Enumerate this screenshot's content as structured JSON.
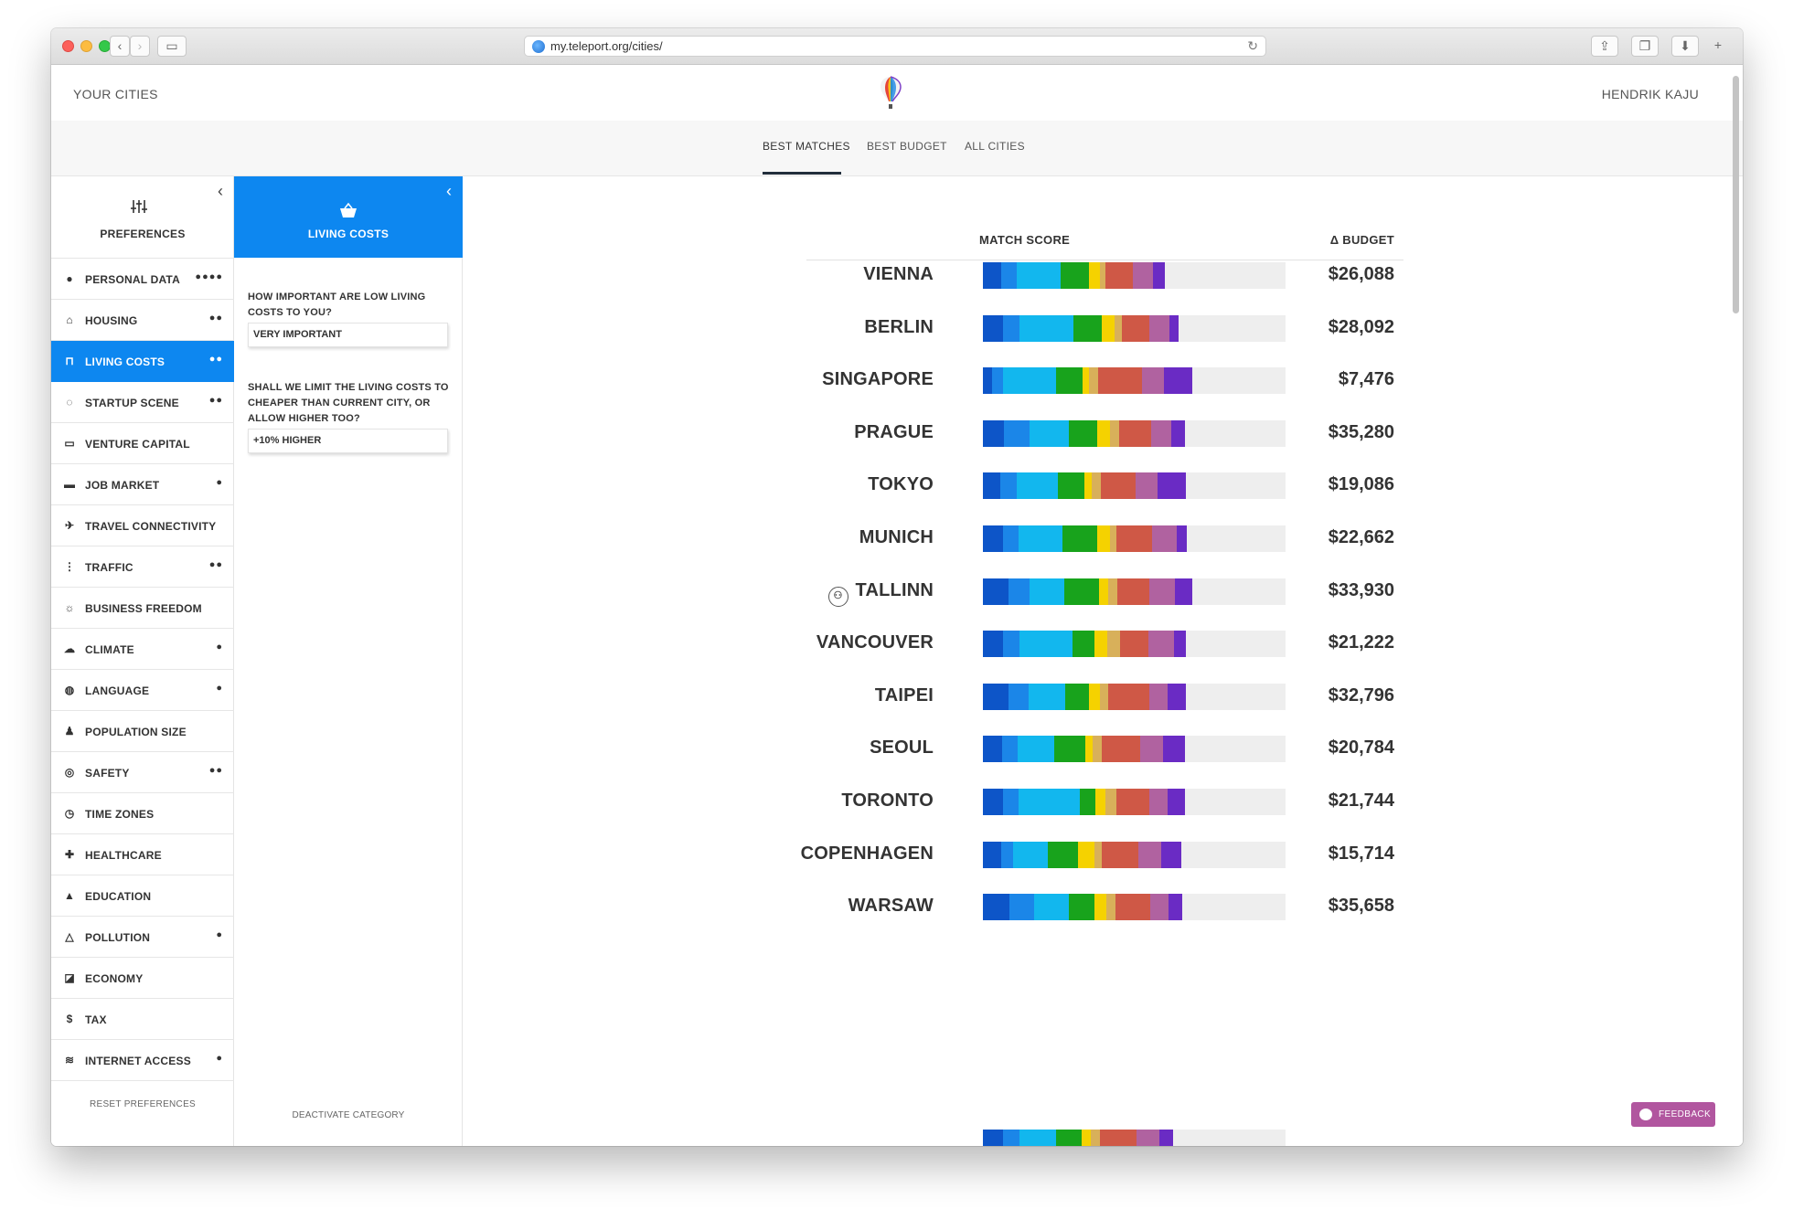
{
  "browser": {
    "url": "my.teleport.org/cities/"
  },
  "header": {
    "left_link": "YOUR CITIES",
    "user_name": "HENDRIK KAJU",
    "tabs": [
      {
        "label": "BEST MATCHES",
        "active": true
      },
      {
        "label": "BEST BUDGET",
        "active": false
      },
      {
        "label": "ALL CITIES",
        "active": false
      }
    ]
  },
  "sidebar": {
    "title": "PREFERENCES",
    "reset_label": "RESET PREFERENCES",
    "items": [
      {
        "label": "PERSONAL DATA",
        "icon": "user-icon",
        "glyph": "●",
        "dots": "●●●●",
        "active": false
      },
      {
        "label": "HOUSING",
        "icon": "house-icon",
        "glyph": "⌂",
        "dots": "●●",
        "active": false
      },
      {
        "label": "LIVING COSTS",
        "icon": "basket-icon",
        "glyph": "⊓",
        "dots": "●●",
        "active": true
      },
      {
        "label": "STARTUP SCENE",
        "icon": "startup-icon",
        "glyph": "◌",
        "dots": "●●",
        "active": false
      },
      {
        "label": "VENTURE CAPITAL",
        "icon": "card-icon",
        "glyph": "▭",
        "dots": "",
        "active": false
      },
      {
        "label": "JOB MARKET",
        "icon": "briefcase-icon",
        "glyph": "▬",
        "dots": "●",
        "active": false
      },
      {
        "label": "TRAVEL CONNECTIVITY",
        "icon": "plane-icon",
        "glyph": "✈",
        "dots": "",
        "active": false
      },
      {
        "label": "TRAFFIC",
        "icon": "traffic-light-icon",
        "glyph": "⋮",
        "dots": "●●",
        "active": false
      },
      {
        "label": "BUSINESS FREEDOM",
        "icon": "sun-icon",
        "glyph": "☼",
        "dots": "",
        "active": false
      },
      {
        "label": "CLIMATE",
        "icon": "cloud-icon",
        "glyph": "☁",
        "dots": "●",
        "active": false
      },
      {
        "label": "LANGUAGE",
        "icon": "globe-icon",
        "glyph": "◍",
        "dots": "●",
        "active": false
      },
      {
        "label": "POPULATION SIZE",
        "icon": "people-icon",
        "glyph": "♟",
        "dots": "",
        "active": false
      },
      {
        "label": "SAFETY",
        "icon": "lifebuoy-icon",
        "glyph": "◎",
        "dots": "●●",
        "active": false
      },
      {
        "label": "TIME ZONES",
        "icon": "clock-icon",
        "glyph": "◷",
        "dots": "",
        "active": false
      },
      {
        "label": "HEALTHCARE",
        "icon": "hospital-icon",
        "glyph": "✚",
        "dots": "",
        "active": false
      },
      {
        "label": "EDUCATION",
        "icon": "graduation-cap-icon",
        "glyph": "▲",
        "dots": "",
        "active": false
      },
      {
        "label": "POLLUTION",
        "icon": "warning-icon",
        "glyph": "△",
        "dots": "●",
        "active": false
      },
      {
        "label": "ECONOMY",
        "icon": "chart-icon",
        "glyph": "◪",
        "dots": "",
        "active": false
      },
      {
        "label": "TAX",
        "icon": "dollar-icon",
        "glyph": "$",
        "dots": "",
        "active": false
      },
      {
        "label": "INTERNET ACCESS",
        "icon": "wifi-icon",
        "glyph": "≋",
        "dots": "●",
        "active": false
      }
    ]
  },
  "subpanel": {
    "title": "LIVING COSTS",
    "question1": "HOW IMPORTANT ARE LOW LIVING COSTS TO YOU?",
    "answer1": "VERY IMPORTANT",
    "question2": "SHALL WE LIMIT THE LIVING COSTS TO CHEAPER THAN CURRENT CITY, OR ALLOW HIGHER TOO?",
    "answer2": "+10% HIGHER",
    "deactivate_label": "DEACTIVATE CATEGORY"
  },
  "main": {
    "match_score_header": "MATCH SCORE",
    "budget_header": "Δ BUDGET",
    "segment_colors": [
      "#0d55c8",
      "#1b86e8",
      "#12b7ee",
      "#18a31c",
      "#f5d200",
      "#d8b05a",
      "#cf5846",
      "#b062a0",
      "#6a2bc4"
    ],
    "max_score": 331,
    "cities": [
      {
        "name": "VIENNA",
        "budget": "$26,088",
        "badge": false,
        "segments": [
          20,
          17,
          48,
          31,
          12,
          6,
          30,
          22,
          13
        ]
      },
      {
        "name": "BERLIN",
        "budget": "$28,092",
        "badge": false,
        "segments": [
          22,
          18,
          59,
          31,
          14,
          8,
          30,
          22,
          10
        ]
      },
      {
        "name": "SINGAPORE",
        "budget": "$7,476",
        "badge": false,
        "segments": [
          10,
          12,
          58,
          29,
          7,
          10,
          48,
          24,
          31
        ]
      },
      {
        "name": "PRAGUE",
        "budget": "$35,280",
        "badge": false,
        "segments": [
          23,
          28,
          43,
          31,
          14,
          10,
          35,
          22,
          15
        ]
      },
      {
        "name": "TOKYO",
        "budget": "$19,086",
        "badge": false,
        "segments": [
          19,
          18,
          45,
          29,
          8,
          10,
          38,
          24,
          31
        ]
      },
      {
        "name": "MUNICH",
        "budget": "$22,662",
        "badge": false,
        "segments": [
          22,
          17,
          48,
          38,
          14,
          7,
          39,
          27,
          11
        ]
      },
      {
        "name": "TALLINN",
        "budget": "$33,930",
        "badge": true,
        "segments": [
          28,
          23,
          38,
          38,
          10,
          10,
          35,
          28,
          19
        ]
      },
      {
        "name": "VANCOUVER",
        "budget": "$21,222",
        "badge": false,
        "segments": [
          22,
          18,
          58,
          24,
          14,
          14,
          31,
          28,
          13
        ]
      },
      {
        "name": "TAIPEI",
        "budget": "$32,796",
        "badge": false,
        "segments": [
          28,
          22,
          40,
          26,
          12,
          9,
          45,
          20,
          20
        ]
      },
      {
        "name": "SEOUL",
        "budget": "$20,784",
        "badge": false,
        "segments": [
          21,
          17,
          40,
          34,
          8,
          10,
          42,
          25,
          24
        ]
      },
      {
        "name": "TORONTO",
        "budget": "$21,744",
        "badge": false,
        "segments": [
          22,
          17,
          67,
          17,
          11,
          12,
          36,
          20,
          19
        ]
      },
      {
        "name": "COPENHAGEN",
        "budget": "$15,714",
        "badge": false,
        "segments": [
          20,
          13,
          38,
          33,
          18,
          8,
          40,
          25,
          22
        ]
      },
      {
        "name": "WARSAW",
        "budget": "$35,658",
        "badge": false,
        "segments": [
          29,
          27,
          38,
          28,
          13,
          10,
          38,
          20,
          15
        ]
      },
      {
        "name": "",
        "budget": "",
        "badge": false,
        "segments": [
          22,
          18,
          40,
          28,
          10,
          10,
          40,
          25,
          15
        ]
      }
    ]
  },
  "feedback_label": "FEEDBACK"
}
